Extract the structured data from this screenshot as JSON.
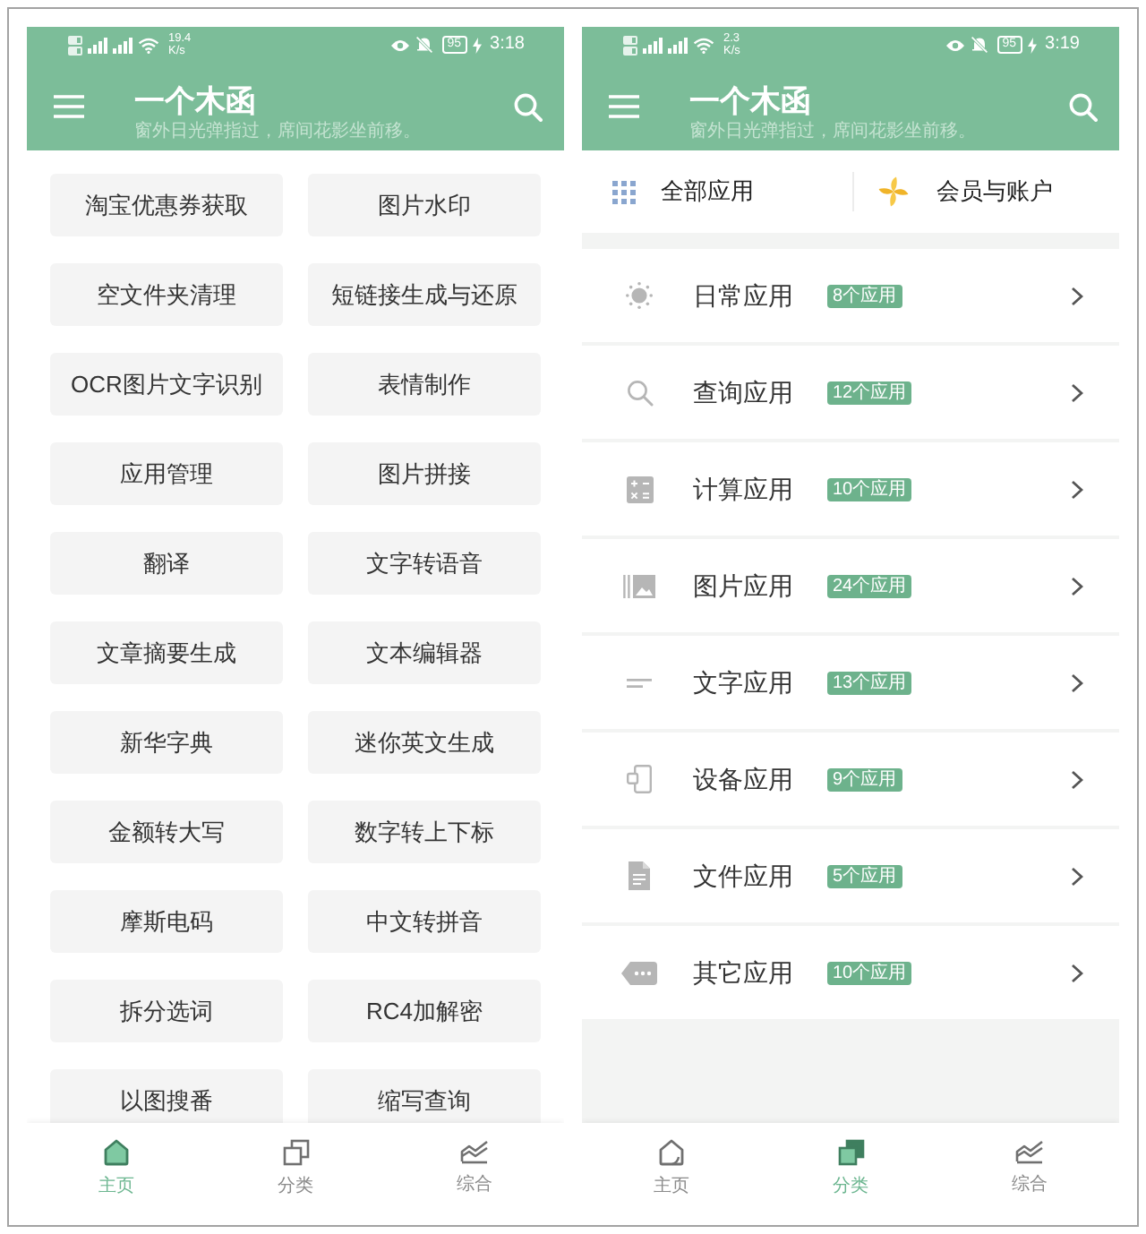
{
  "screens": [
    {
      "kind": "home",
      "status_bar": {
        "speed": "19.4",
        "speed_unit": "K/s",
        "battery": "95",
        "time": "3:18"
      },
      "app_bar": {
        "title": "一个木函",
        "subtitle": "窗外日光弹指过，席间花影坐前移。"
      },
      "tools": [
        "淘宝优惠券获取",
        "图片水印",
        "空文件夹清理",
        "短链接生成与还原",
        "OCR图片文字识别",
        "表情制作",
        "应用管理",
        "图片拼接",
        "翻译",
        "文字转语音",
        "文章摘要生成",
        "文本编辑器",
        "新华字典",
        "迷你英文生成",
        "金额转大写",
        "数字转上下标",
        "摩斯电码",
        "中文转拼音",
        "拆分选词",
        "RC4加解密",
        "以图搜番",
        "缩写查询"
      ],
      "bottom_nav": [
        {
          "label": "主页",
          "selected": true
        },
        {
          "label": "分类",
          "selected": false
        },
        {
          "label": "综合",
          "selected": false
        }
      ]
    },
    {
      "kind": "categories",
      "status_bar": {
        "speed": "2.3",
        "speed_unit": "K/s",
        "battery": "95",
        "time": "3:19"
      },
      "app_bar": {
        "title": "一个木函",
        "subtitle": "窗外日光弹指过，席间花影坐前移。"
      },
      "shortcuts": [
        "全部应用",
        "会员与账户"
      ],
      "categories": [
        {
          "name": "日常应用",
          "count": "8个应用"
        },
        {
          "name": "查询应用",
          "count": "12个应用"
        },
        {
          "name": "计算应用",
          "count": "10个应用"
        },
        {
          "name": "图片应用",
          "count": "24个应用"
        },
        {
          "name": "文字应用",
          "count": "13个应用"
        },
        {
          "name": "设备应用",
          "count": "9个应用"
        },
        {
          "name": "文件应用",
          "count": "5个应用"
        },
        {
          "name": "其它应用",
          "count": "10个应用"
        }
      ],
      "bottom_nav": [
        {
          "label": "主页",
          "selected": false
        },
        {
          "label": "分类",
          "selected": true
        },
        {
          "label": "综合",
          "selected": false
        }
      ]
    }
  ]
}
